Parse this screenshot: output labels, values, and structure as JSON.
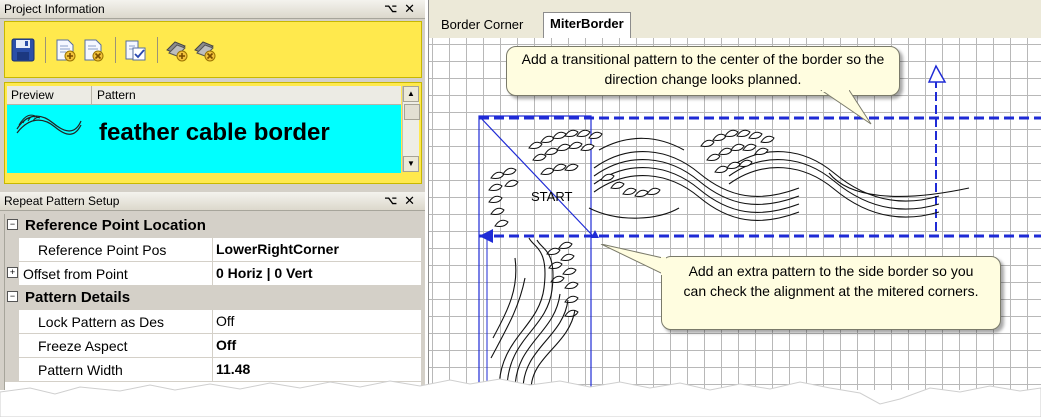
{
  "project_panel": {
    "title": "Project Information",
    "pin_icon": "ā",
    "close_icon": "✕",
    "toolbar_icons": [
      "save-icon",
      "new-pattern-icon",
      "delete-pattern-icon",
      "preview-doc-icon",
      "add-group-icon",
      "remove-group-icon"
    ]
  },
  "preview_table": {
    "headers": [
      "Preview",
      "Pattern"
    ],
    "rows": [
      {
        "pattern": "feather cable border"
      }
    ],
    "row_color": "#00ffff"
  },
  "repeat_panel": {
    "title": "Repeat Pattern Setup",
    "pin_icon": "ā",
    "close_icon": "✕"
  },
  "properties": {
    "cat1": "Reference Point Location",
    "p1_name": "Reference Point Pos",
    "p1_value": "LowerRightCorner",
    "p2_name": "Offset from Point",
    "p2_value": "0 Horiz | 0 Vert",
    "cat2": "Pattern Details",
    "p3_name": "Lock Pattern as Des",
    "p3_value": "Off",
    "p4_name": "Freeze Aspect",
    "p4_value": "Off",
    "p5_name": "Pattern Width",
    "p5_value": "11.48",
    "expanded_sign": "⊟",
    "collapsed_sign": "⊞"
  },
  "tabs": [
    {
      "label": "Border Corner",
      "active": false
    },
    {
      "label": "MiterBorder",
      "active": true
    }
  ],
  "canvas": {
    "start_label": "START",
    "callout_top": "Add a transitional pattern to the center of the border so the direction change looks planned.",
    "callout_bottom": "Add an extra pattern to the side border so you can check the alignment at the mitered corners."
  },
  "colors": {
    "toolbar_bg": "#ffe94d",
    "selection": "#00ffff",
    "blue": "#1f2bd6",
    "callout_bg": "#fffde0"
  }
}
